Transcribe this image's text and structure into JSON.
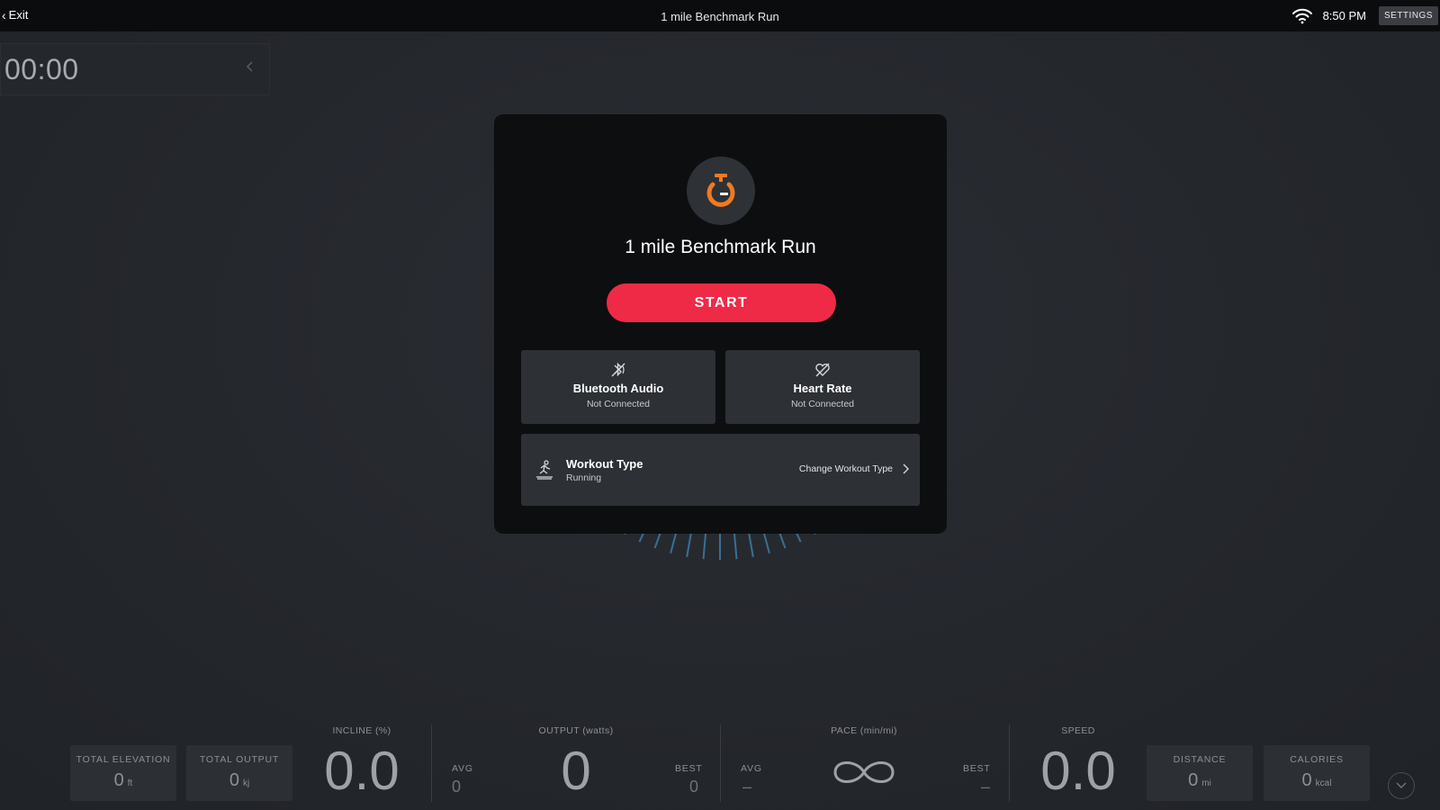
{
  "topbar": {
    "exit_label": "Exit",
    "title": "1 mile Benchmark Run",
    "time": "8:50 PM",
    "settings_label": "SETTINGS"
  },
  "timer": {
    "value": "00:00"
  },
  "modal": {
    "title": "1 mile Benchmark Run",
    "start_label": "START",
    "bluetooth": {
      "label": "Bluetooth Audio",
      "status": "Not Connected",
      "icon": "bluetooth-audio-icon"
    },
    "heart_rate": {
      "label": "Heart Rate",
      "status": "Not Connected",
      "icon": "heart-rate-icon"
    },
    "workout_type": {
      "label": "Workout Type",
      "value": "Running",
      "change_label": "Change Workout Type",
      "icon": "running-icon"
    },
    "accent_color": "#ef2a47",
    "logo_color": "#f07a22"
  },
  "metrics": {
    "total_elevation": {
      "label": "TOTAL ELEVATION",
      "value": "0",
      "unit": "ft"
    },
    "total_output": {
      "label": "TOTAL OUTPUT",
      "value": "0",
      "unit": "kj"
    },
    "incline": {
      "label": "INCLINE (%)",
      "value": "0.0"
    },
    "output": {
      "label": "OUTPUT (watts)",
      "value": "0",
      "avg_label": "AVG",
      "avg_value": "0",
      "best_label": "BEST",
      "best_value": "0"
    },
    "pace": {
      "label": "PACE (min/mi)",
      "value": "∞",
      "avg_label": "AVG",
      "avg_value": "–",
      "best_label": "BEST",
      "best_value": "–"
    },
    "speed": {
      "label": "SPEED",
      "value": "0.0"
    },
    "distance": {
      "label": "DISTANCE",
      "value": "0",
      "unit": "mi"
    },
    "calories": {
      "label": "CALORIES",
      "value": "0",
      "unit": "kcal"
    }
  }
}
